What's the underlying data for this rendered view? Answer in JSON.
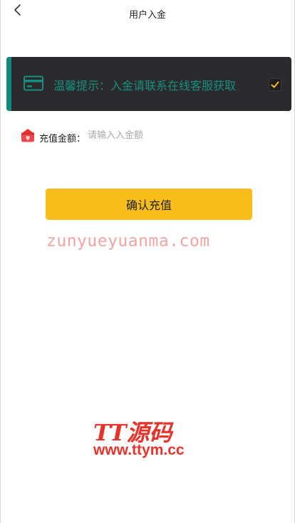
{
  "header": {
    "title": "用户入金",
    "back_icon": "chevron-left-icon"
  },
  "notice": {
    "text": "温馨提示：入金请联系在线客服获取",
    "card_icon": "credit-card-icon",
    "check_icon": "check-icon",
    "bg_color": "#2b2b2d",
    "accent_color": "#0f8a7c",
    "text_color": "#168f80",
    "check_color": "#f9bd1b"
  },
  "amount": {
    "icon": "yuan-wallet-icon",
    "label": "充值金额：",
    "placeholder": "请输入入金额",
    "value": ""
  },
  "confirm": {
    "label": "确认充值",
    "color": "#f9bd1b"
  },
  "watermark": {
    "url_text": "zunyueyuanma.com",
    "logo_title": "TT源码",
    "logo_url": "www.ttym.cc",
    "logo_color": "#e8332c"
  }
}
